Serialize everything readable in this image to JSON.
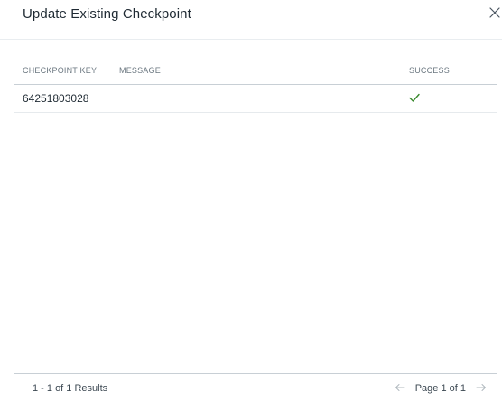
{
  "dialog": {
    "title": "Update Existing Checkpoint",
    "close_icon": "close-icon"
  },
  "table": {
    "columns": {
      "checkpoint_key": "CHECKPOINT KEY",
      "message": "MESSAGE",
      "success": "SUCCESS"
    },
    "rows": [
      {
        "checkpoint_key": "64251803028",
        "message": "",
        "success_icon": "checkmark-icon",
        "success_color": "#3a8a2e"
      }
    ]
  },
  "footer": {
    "results_text": "1 - 1 of 1 Results",
    "page_text": "Page 1 of 1",
    "prev_icon": "arrow-left-icon",
    "next_icon": "arrow-right-icon"
  }
}
